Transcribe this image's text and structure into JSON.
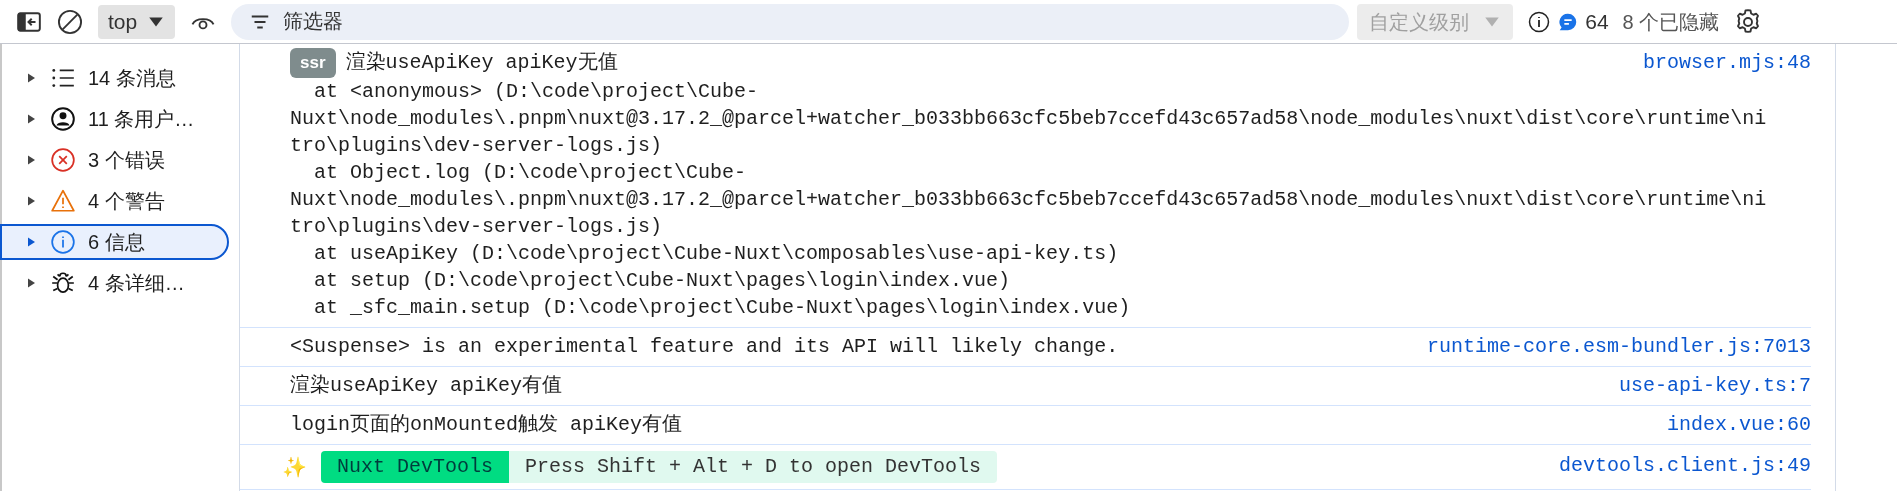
{
  "toolbar": {
    "context": "top",
    "filter_placeholder": "筛选器",
    "levels_label": "自定义级别",
    "issues_count": "64",
    "hidden_label": "8 个已隐藏"
  },
  "sidebar": {
    "items": [
      {
        "kind": "list",
        "label": "14 条消息",
        "selected": false
      },
      {
        "kind": "user",
        "label": "11 条用户…",
        "selected": false
      },
      {
        "kind": "error",
        "label": "3 个错误",
        "selected": false
      },
      {
        "kind": "warning",
        "label": "4 个警告",
        "selected": false
      },
      {
        "kind": "info",
        "label": "6 信息",
        "selected": true
      },
      {
        "kind": "verbose",
        "label": "4 条详细…",
        "selected": false
      }
    ]
  },
  "messages": [
    {
      "kind": "stack",
      "badge": "ssr",
      "text": "渲染useApiKey apiKey无值",
      "stack": "  at <anonymous> (D:\\code\\project\\Cube-\nNuxt\\node_modules\\.pnpm\\nuxt@3.17.2_@parcel+watcher_b033bb663cfc5beb7ccefd43c657ad58\\node_modules\\nuxt\\dist\\core\\runtime\\ni\ntro\\plugins\\dev-server-logs.js)\n  at Object.log (D:\\code\\project\\Cube-\nNuxt\\node_modules\\.pnpm\\nuxt@3.17.2_@parcel+watcher_b033bb663cfc5beb7ccefd43c657ad58\\node_modules\\nuxt\\dist\\core\\runtime\\ni\ntro\\plugins\\dev-server-logs.js)\n  at useApiKey (D:\\code\\project\\Cube-Nuxt\\composables\\use-api-key.ts)\n  at setup (D:\\code\\project\\Cube-Nuxt\\pages\\login\\index.vue)\n  at _sfc_main.setup (D:\\code\\project\\Cube-Nuxt\\pages\\login\\index.vue)",
      "source": "browser.mjs:48"
    },
    {
      "kind": "plain",
      "text": "<Suspense> is an experimental feature and its API will likely change.",
      "source": "runtime-core.esm-bundler.js:7013"
    },
    {
      "kind": "plain",
      "text": "渲染useApiKey apiKey有值",
      "source": "use-api-key.ts:7"
    },
    {
      "kind": "plain",
      "text": "login页面的onMounted触发 apiKey有值",
      "source": "index.vue:60"
    },
    {
      "kind": "devtools",
      "icon": "✨",
      "badge": "Nuxt DevTools",
      "text": "Press Shift + Alt + D to open DevTools",
      "source": "devtools.client.js:49"
    }
  ]
}
